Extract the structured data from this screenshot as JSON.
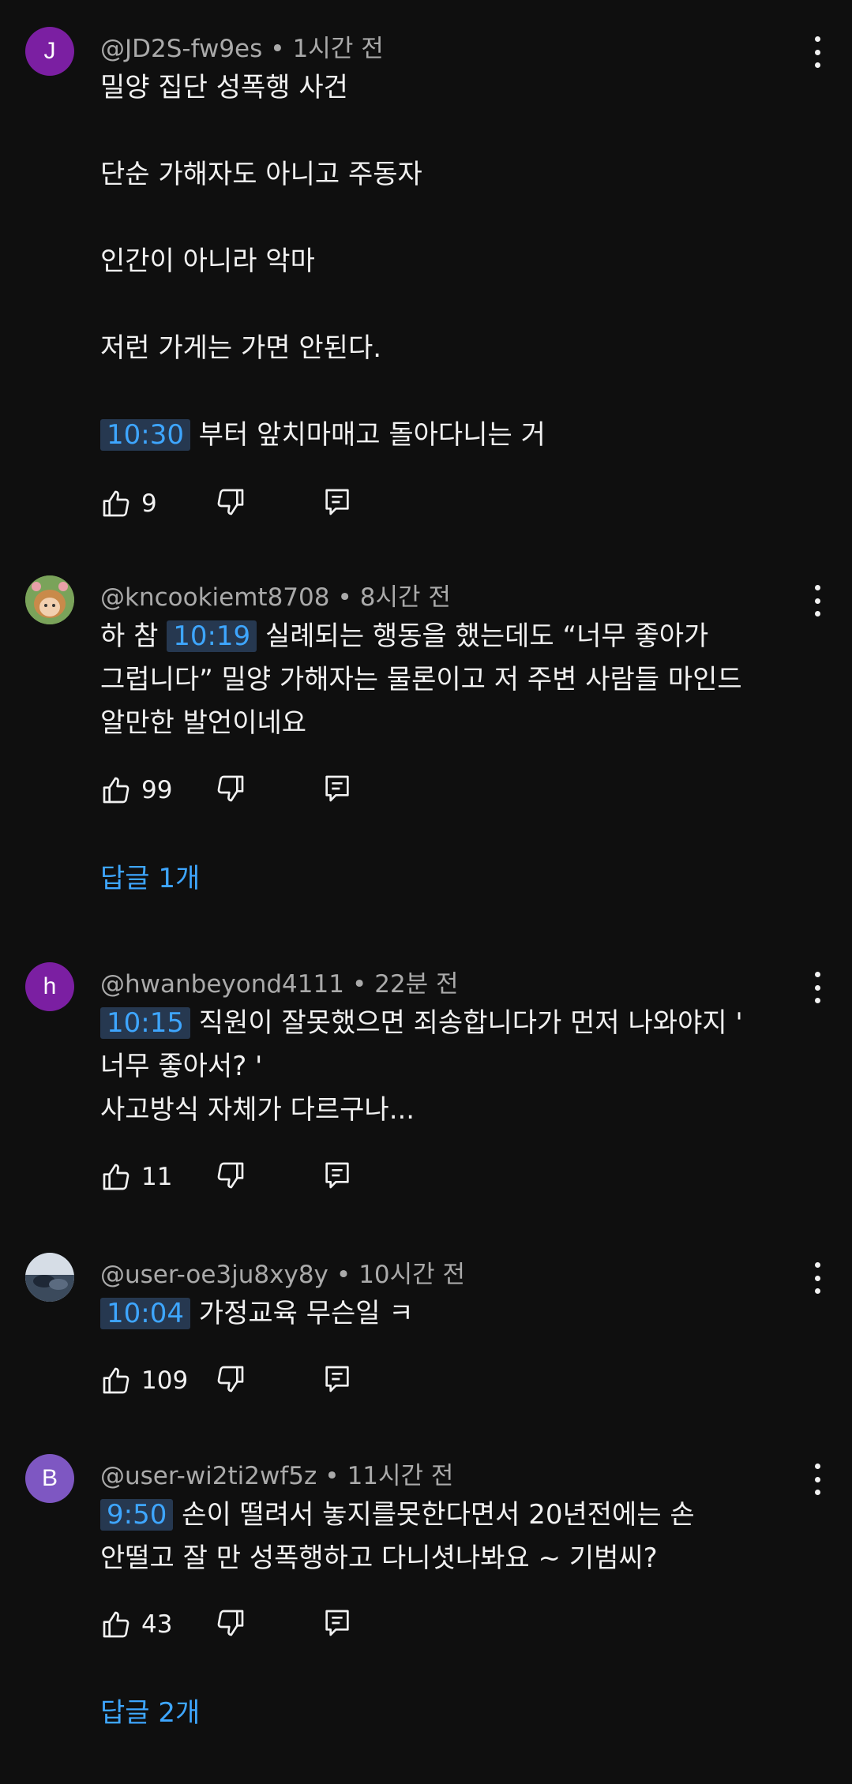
{
  "colors": {
    "background": "#0f0f0f",
    "text": "#f1f1f1",
    "muted": "#aaaaaa",
    "link": "#3ea6ff",
    "timestamp_bg": "#263850"
  },
  "comments": [
    {
      "author": "@JD2S-fw9es",
      "time": "1시간 전",
      "avatar_letter": "J",
      "avatar_color": "#7b1fa2",
      "lines": [
        "밀양 집단 성폭행 사건",
        "",
        "단순 가해자도 아니고 주동자",
        "",
        "인간이 아니라 악마",
        "",
        "저런 가게는 가면 안된다.",
        ""
      ],
      "last_ts": "10:30",
      "last_text": "부터 앞치마매고 돌아다니는 거",
      "likes": "9"
    },
    {
      "author": "@kncookiemt8708",
      "time": "8시간 전",
      "avatar_icon": "cartoon-character-avatar",
      "line1_pre": "하 참",
      "line1_ts": "10:19",
      "line1_post": "실례되는 행동을 했는데도 “너무 좋아가",
      "line2": "그럽니다” 밀양 가해자는 물론이고 저 주변 사람들 마인드",
      "line3": "알만한 발언이네요",
      "likes": "99",
      "replies": "답글 1개"
    },
    {
      "author": "@hwanbeyond4111",
      "time": "22분 전",
      "avatar_letter": "h",
      "avatar_color": "#7b1fa2",
      "line1_ts": "10:15",
      "line1_post": "직원이 잘못했으면 죄송합니다가 먼저 나와야지 '",
      "line2": "너무 좋아서? '",
      "line3": "사고방식 자체가 다르구나...",
      "likes": "11"
    },
    {
      "author": "@user-oe3ju8xy8y",
      "time": "10시간 전",
      "avatar_icon": "photo-avatar",
      "line1_ts": "10:04",
      "line1_post": "가정교육 무슨일 ㅋ",
      "likes": "109"
    },
    {
      "author": "@user-wi2ti2wf5z",
      "time": "11시간 전",
      "avatar_letter": "B",
      "avatar_color": "#7e57c2",
      "line1_ts": "9:50",
      "line1_post": "손이 떨려서 놓지를못한다면서 20년전에는 손",
      "line2": "안떨고 잘 만 성폭행하고 다니셧나봐요 ~ 기범씨?",
      "likes": "43",
      "replies": "답글 2개"
    }
  ],
  "icons": [
    "like-icon",
    "dislike-icon",
    "reply-icon",
    "more-icon"
  ]
}
